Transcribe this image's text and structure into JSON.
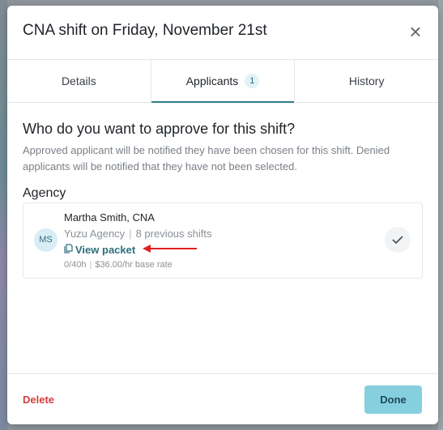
{
  "modal": {
    "title": "CNA shift on Friday, November 21st",
    "close_symbol": "×"
  },
  "tabs": [
    {
      "label": "Details"
    },
    {
      "label": "Applicants",
      "badge": "1"
    },
    {
      "label": "History"
    }
  ],
  "main": {
    "question": "Who do you want to approve for this shift?",
    "subtext": "Approved applicant will be notified they have been chosen for this shift. Denied applicants will be notified that they have not been selected.",
    "section_heading": "Agency"
  },
  "applicant": {
    "initials": "MS",
    "name": "Martha Smith, CNA",
    "agency": "Yuzu Agency",
    "previous_shifts": "8 previous shifts",
    "packet_label": "View packet",
    "hours": "0/40h",
    "rate": "$36.00/hr base rate",
    "separator": "|"
  },
  "footer": {
    "delete_label": "Delete",
    "done_label": "Done"
  },
  "colors": {
    "accent": "#2e6f7d",
    "done_bg": "#86cfdf",
    "danger": "#d43d3d",
    "annotation_arrow": "#e02020"
  },
  "icons": {
    "close": "close-icon",
    "packet": "document-icon",
    "approve": "checkmark-icon"
  }
}
